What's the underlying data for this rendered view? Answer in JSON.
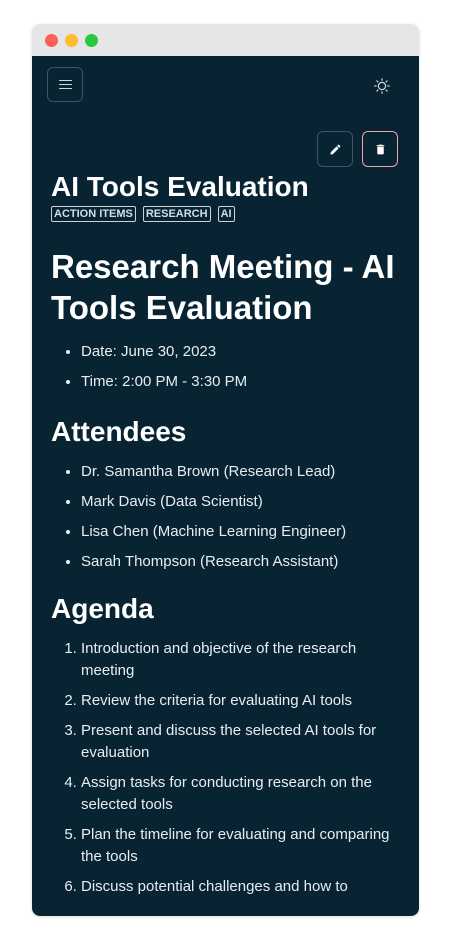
{
  "window": {
    "controls": [
      "close",
      "minimize",
      "zoom"
    ]
  },
  "toolbar": {
    "menu_icon": "hamburger-icon",
    "theme_icon": "sun-icon",
    "edit_icon": "pencil-icon",
    "delete_icon": "trash-icon"
  },
  "note": {
    "title": "AI Tools Evaluation",
    "tags": [
      "ACTION ITEMS",
      "RESEARCH",
      "AI"
    ]
  },
  "content": {
    "heading": "Research Meeting - AI Tools Evaluation",
    "meta": [
      "Date: June 30, 2023",
      "Time: 2:00 PM - 3:30 PM"
    ],
    "attendees_heading": "Attendees",
    "attendees": [
      "Dr. Samantha Brown (Research Lead)",
      "Mark Davis (Data Scientist)",
      "Lisa Chen (Machine Learning Engineer)",
      "Sarah Thompson (Research Assistant)"
    ],
    "agenda_heading": "Agenda",
    "agenda": [
      "Introduction and objective of the research meeting",
      "Review the criteria for evaluating AI tools",
      "Present and discuss the selected AI tools for evaluation",
      "Assign tasks for conducting research on the selected tools",
      "Plan the timeline for evaluating and comparing the tools",
      "Discuss potential challenges and how to"
    ]
  },
  "colors": {
    "background": "#082433",
    "text": "#ffffff",
    "delete_border": "#f2a6a6"
  }
}
